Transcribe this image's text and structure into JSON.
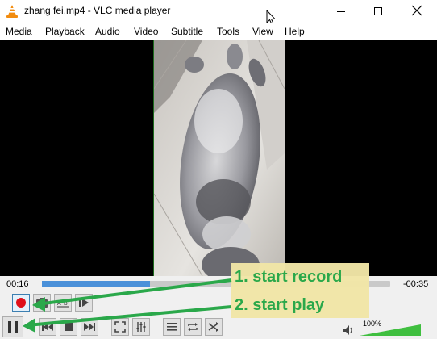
{
  "window": {
    "title": "zhang fei.mp4 - VLC media player",
    "icons": [
      "vlc-cone-icon",
      "cursor-icon",
      "minimize-icon",
      "maximize-icon",
      "close-icon"
    ]
  },
  "menu": {
    "items": [
      {
        "label": "Media"
      },
      {
        "label": "Playback"
      },
      {
        "label": "Audio"
      },
      {
        "label": "Video"
      },
      {
        "label": "Subtitle"
      },
      {
        "label": "Tools"
      },
      {
        "label": "View"
      },
      {
        "label": "Help"
      }
    ]
  },
  "playback": {
    "elapsed": "00:16",
    "remaining": "-00:35",
    "progress": 0.31
  },
  "controls": {
    "row1": [
      "record-icon",
      "snapshot-icon",
      "loop-ab-icon",
      "frame-step-icon"
    ],
    "row2": [
      "pause-icon",
      "previous-icon",
      "stop-icon",
      "next-icon",
      "fullscreen-icon",
      "extended-settings-icon",
      "playlist-icon",
      "loop-icon",
      "shuffle-icon"
    ]
  },
  "volume": {
    "label": "100%",
    "level": 1.0,
    "icon": "speaker-icon"
  },
  "annotations": {
    "step1": "1. start record",
    "step2": "2. start play",
    "color": "#2aa84a",
    "box_color": "#f1e5a6"
  },
  "colors": {
    "seek_fill": "#4a90d9",
    "volume_fill": "#3fbf3f",
    "vlc_orange": "#f28c0f"
  }
}
